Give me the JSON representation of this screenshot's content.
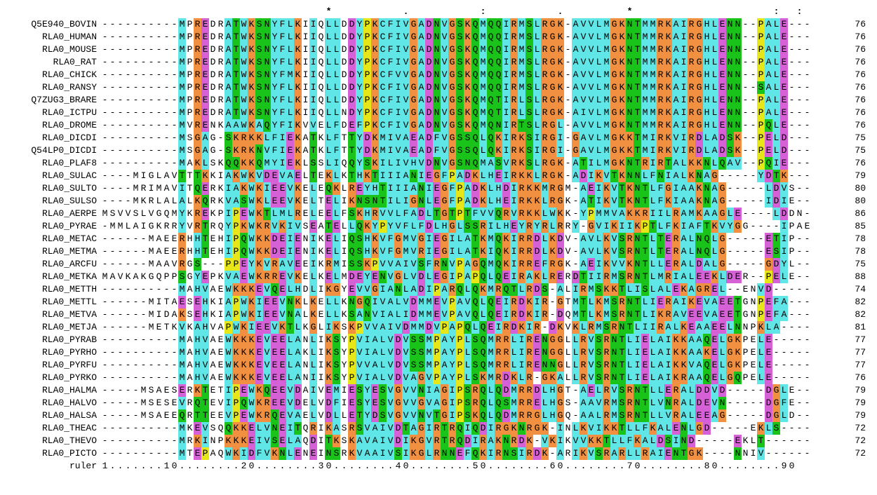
{
  "header_line": "                             *         .         :         .        *                  :  : :          .",
  "ruler_label": "ruler",
  "ruler_text": "1.......10........20........30........40........50........60........70........80........90",
  "rows": [
    {
      "label": "Q5E940_BOVIN",
      "seq": "----------MPREDRATWKSNYFLKIIQLLDDYPKCFIVGADNVGSKQMQQIRMSLRGK-AVVLMGKNTMMRKAIRGHLENN--PALE",
      "count": 76
    },
    {
      "label": "RLA0_HUMAN",
      "seq": "----------MPREDRATWKSNYFLKIIQLLDDYPKCFIVGADNVGSKQMQQIRMSLRGK-AVVLMGKNTMMRKAIRGHLENN--PALE",
      "count": 76
    },
    {
      "label": "RLA0_MOUSE",
      "seq": "----------MPREDRATWKSNYFLKIIQLLDDYPKCFIVGADNVGSKQMQQIRMSLRGK-AVVLMGKNTMMRKAIRGHLENN--PALE",
      "count": 76
    },
    {
      "label": "RLA0_RAT",
      "seq": "----------MPREDRATWKSNYFLKIIQLLDDYPKCFIVGADNVGSKQMQQIRMSLRGK-AVVLMGKNTMMRKAIRGHLENN--PALE",
      "count": 76
    },
    {
      "label": "RLA0_CHICK",
      "seq": "----------MPREDRATWKSNYFMKIIQLLDDYPKCFVVGADNVGSKQMQQIRMSLRGK-AVVLMGKNTMMRKAIRGHLENN--PALE",
      "count": 76
    },
    {
      "label": "RLA0_RANSY",
      "seq": "----------MPREDRATWKSNYFLKIIQLLDDYPKCFIVGADNVGSKQMQQIRMSLRGK-AVVLMGKNTMMRKAIRGHLENN--SALE",
      "count": 76
    },
    {
      "label": "Q7ZUG3_BRARE",
      "seq": "----------MPREDRATWKSNYFLKIIQLLDDYPKCFIVGADNVGSKQMQTIRLSLRGK-AVVLMGKNTMMRKAIRGHLENN--PALE",
      "count": 76
    },
    {
      "label": "RLA0_ICTPU",
      "seq": "----------MPREDRATWKSNYFLKIIQLLNDYPKCFIVGADNVGSKQMQTIRLSLRGK-AIVLMGKNTMMRKAIRGHLENN--PALE",
      "count": 76
    },
    {
      "label": "RLA0_DROME",
      "seq": "----------MVRENKAAWKAQYFIKVVELFDEFPKCFIVGADNVGSKQMQNIRTSLRGL-AVVLMGKNTMMRKAIRGHLENN--PQLE",
      "count": 76
    },
    {
      "label": "RLA0_DICDI",
      "seq": "----------MSGAG-SKRKKLFIEKATKLFTTYDKMIVAEADFVGSSQLQKIRKSIRGI-GAVLMGKKTMIRKVIRDLADSK--PELD",
      "count": 75
    },
    {
      "label": "Q54LP0_DICDI",
      "seq": "----------MSGAG-SKRKNVFIEKATKLFTTYDKMIVAEADFVGSSQLQKIRKSIRGI-GAVLMGKKTMIRKVIRDLADSK--PELD",
      "count": 75
    },
    {
      "label": "RLA0_PLAF8",
      "seq": "----------MAKLSKQQKKQMYIEKLSSLIQQYSKILIVHVDNVGSNQMASVRKSLRGK-ATILMGKNTRIRTALKKNLQAV--PQIE",
      "count": 76
    },
    {
      "label": "RLA0_SULAC",
      "seq": "----MIGLAVTTTKKIAKWKVDEVAELTEKLKTHKTIIIANIEGFPADKLHEIRKKLRGK-ADIKVTKNNLFNIALKNAG-----YDTK",
      "count": 79
    },
    {
      "label": "RLA0_SULTO",
      "seq": "----MRIMAVITQERKIAKWKIEEVKELEQKLREYHTIIIANIEGFPADKLHDIRKKMRGM-AEIKVTKNTLFGIAAKNAG-----LDVS",
      "count": 80
    },
    {
      "label": "RLA0_SULSO",
      "seq": "----MKRLALALKQRKVASWKLEEVKELTELIKNSNTILIGNLEGFPADKLHEIRKKLRGK-ATIKVTKNTLFKIAAKNAG-----IDIE",
      "count": 80
    },
    {
      "label": "RLA0_AERPE",
      "seq": "MSVVSLVGQMYKREKPIPEWKTLMLRELEELFSKHRVVLFADLTGTPTFVVQRVRKKLWKK-YPMMVAKKRIILRAMKAAGLE----LDDN",
      "count": 86
    },
    {
      "label": "RLA0_PYRAE",
      "seq": "-MMLAIGKRRYVRTRQYPKWKRVKIVSEATELLQKYPYVFLFDLHGLSSRILHEYRYRLRRY-GVIKIIKPTLFKIAFTKVYGG----IPAE",
      "count": 85
    },
    {
      "label": "RLA0_METAC",
      "seq": "------MAEERHHTEHIPQWKKDEIENIKELIQSHKVFGMVGIEGILATKMQKIRRDLKDV-AVLKVSRNTLTERALNQLG-----ETIP",
      "count": 78
    },
    {
      "label": "RLA0_METMA",
      "seq": "------MAEERHHTEHIPQWKKDEIENIKELIQSHKVFGMVRIEGILATKIQKIRRDLKDV-AVLKVSRNTLTERALNQLG-----ESIP",
      "count": 78
    },
    {
      "label": "RLA0_ARCFU",
      "seq": "------MAAVRGS---PPEYKVRAVEEIKRMISSKPVVAIVSFRNVPAGQMQKIRREFRGK-AEIKVVKNTLLERALDALG-----GDYL",
      "count": 75
    },
    {
      "label": "RLA0_METKA",
      "seq": "MAVKAKGQPPSGYEPKVAEWKRREVKELKELMDEYENVGLVDLEGIPAPQLQEIRAKLRERDTIIRMSRNTLMRIALEEKLDER--PELE",
      "count": 88
    },
    {
      "label": "RLA0_METTH",
      "seq": "----------MAHVAEWKKKEVQELHDLIKGYEVVGIANLADIPARQLQKMRQTLRDS-ALIRMSKKTLISLALEKAGREL--ENVD",
      "count": 74
    },
    {
      "label": "RLA0_METTL",
      "seq": "------MITAESEHKIAPWKIEEVNKLKELLKNGQIVALVDMMEVPAVQLQEIRDKIR-GTMTLKMSRNTLIERAIKEVAEETGNPEFA",
      "count": 82
    },
    {
      "label": "RLA0_METVA",
      "seq": "------MIDAKSEHKIAPWKIEEVNALKELLKSANVIALIDMMEVPAVQLQEIRDKIR-DQMTLKMSRNTLIKRAVEEVAEETGNPEFA",
      "count": 82
    },
    {
      "label": "RLA0_METJA",
      "seq": "------METKVKAHVAPWKIEEVKTLKGLIKSKPVVAIVDMMDVPAPQLQEIRDKIR-DKVKLRMSRNTLIIRALKEAAEELNNPKLA",
      "count": 81
    },
    {
      "label": "RLA0_PYRAB",
      "seq": "----------MAHVAEWKKKEVEELANLIKSYPVIALVDVSSMPAYPLSQMRRLIRENGGLLRVSRNTLIELAIKKAAQELGKPELE",
      "count": 77
    },
    {
      "label": "RLA0_PYRHO",
      "seq": "----------MAHVAEWKKKEVEELAKLIKSYPVIALVDVSSMPAYPLSQMRRLIRENGGLLRVSRNTLIELAIKKAAKELGKPELE",
      "count": 77
    },
    {
      "label": "RLA0_PYRFU",
      "seq": "----------MAHVAEWKKKEVEELANLIKSYPVVALVDVSSMPAYPLSQMRRLIRENNGLLRVSRNTLIELAIKKVAQELGKPELE",
      "count": 77
    },
    {
      "label": "RLA0_PYRKO",
      "seq": "----------MAHVAEWKKKEVEELANIIKSYPVIALVDVAGVPAYPLSKMRDKLR-GKALLRVSRNTLIELAIKRAAQELGQPELE",
      "count": 76
    },
    {
      "label": "RLA0_HALMA",
      "seq": "-----MSAESERKTETIPEWKQEEVDAIVEMIESYESVGVVNIAGIPSRQLQDMRRDLHGT-AELRVSRNTLLERALDDVD-----DGLE",
      "count": 79
    },
    {
      "label": "RLA0_HALVO",
      "seq": "-----MSESEVRQTEVIPQWKREEVDELVDFIESYESVGVVGVAGIPSRQLQSMRRELHGS-AAVRMSRNTLVNRALDEVN-----DGFE",
      "count": 79
    },
    {
      "label": "RLA0_HALSA",
      "seq": "-----MSAEEQRTTEEVPEWKRQEVAELVDLLETYDSVGVVNVTGIPSKQLQDMRRGLHGQ-AALRMSRNTLLVRALEEAG-----DGLD",
      "count": 79
    },
    {
      "label": "RLA0_THEAC",
      "seq": "----------MKEVSQQKKELVNEITQRIKASRSVAIVDTAGIRTRQIQDIRGKNRGK-INLKVIKKTLLFKALENLGD-----EKLS",
      "count": 72
    },
    {
      "label": "RLA0_THEVO",
      "seq": "----------MRKINPKKKEIVSELAQDITKSKAVAIVDIKGVRTRQDIRAKNRDK-VKIKVVKKTLLFKALDSIND-----EKLT",
      "count": 72
    },
    {
      "label": "RLA0_PICTO",
      "seq": "----------MTEPAQWKIDFVKNLENEINSRKVAAIVSIKGLRNNEFQKIRNSIRDK-ARIKVSRARLLRAIENTGK----NNIV",
      "count": 72
    }
  ],
  "chart_data": null
}
